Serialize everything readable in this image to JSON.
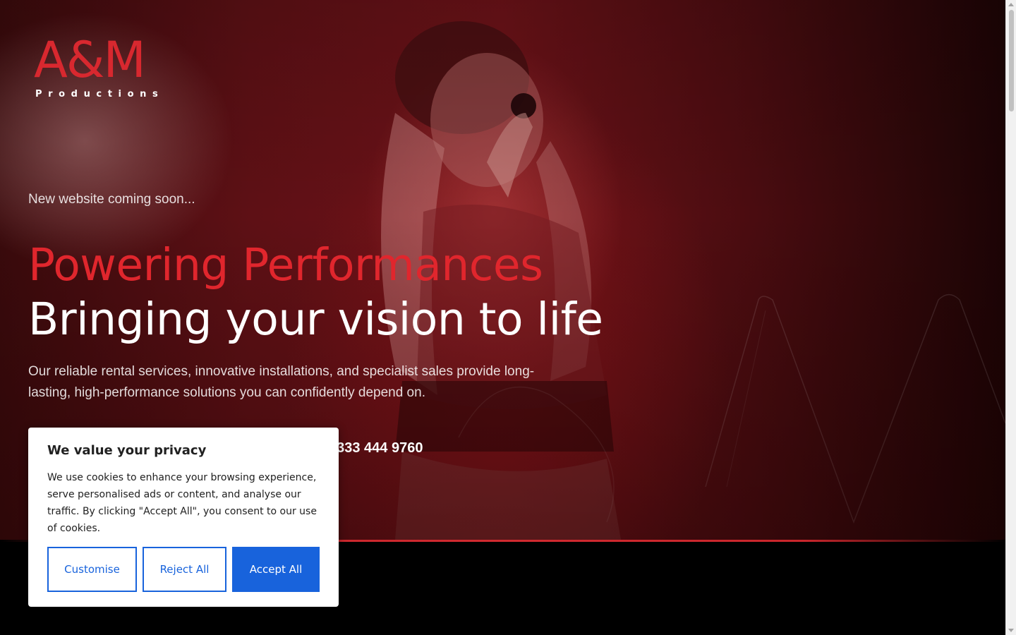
{
  "logo": {
    "mark": "A&M",
    "sub": "Productions"
  },
  "hero": {
    "tagline": "New website coming soon...",
    "headline_red": "Powering Performances",
    "headline_white": "Bringing your vision to life",
    "intro": "Our reliable rental services, innovative installations, and specialist sales provide long-lasting, high-performance solutions you can confidently depend on.",
    "phone": "0333 444 9760"
  },
  "cookie_banner": {
    "title": "We value your privacy",
    "text": "We use cookies to enhance your browsing experience, serve personalised ads or content, and analyse our traffic. By clicking \"Accept All\", you consent to our use of cookies.",
    "customise_label": "Customise",
    "reject_label": "Reject All",
    "accept_label": "Accept All"
  },
  "colors": {
    "brand_red": "#e0262d",
    "cookie_blue": "#1863dc"
  }
}
